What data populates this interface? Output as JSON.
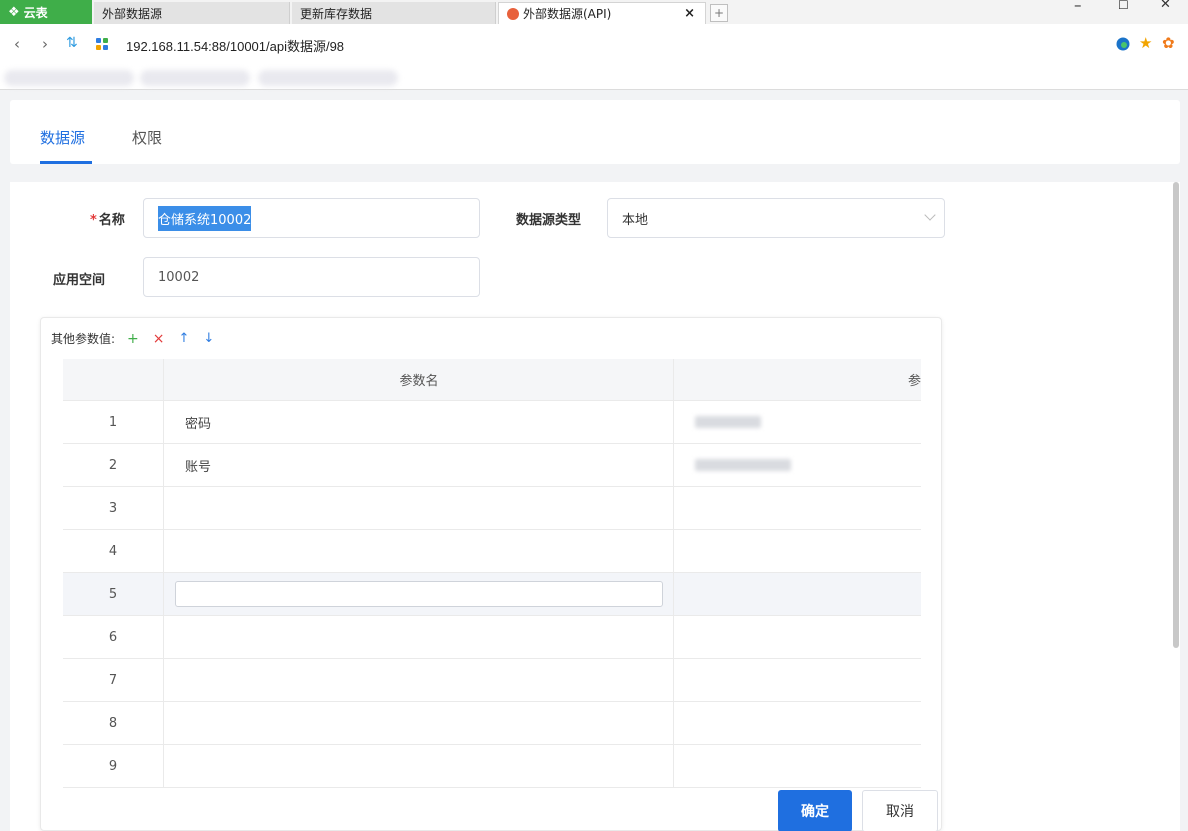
{
  "browser": {
    "tabs": [
      {
        "label": "云表",
        "icon": "yunbiao-logo-icon"
      },
      {
        "label": "外部数据源"
      },
      {
        "label": "更新库存数据"
      },
      {
        "label": "外部数据源(API)",
        "icon": "app-logo-icon",
        "close": "×"
      }
    ],
    "new_tab_glyph": "+",
    "window_controls": {
      "minimize": "–",
      "maximize": "☐",
      "close": "✕"
    },
    "address": "192.168.11.54:88/10001/api数据源/98",
    "accent_green": "#3fae49"
  },
  "page_tabs": [
    {
      "label": "数据源",
      "active": true
    },
    {
      "label": "权限",
      "active": false
    }
  ],
  "form": {
    "name_label": "名称",
    "name_required_mark": "*",
    "name_value": "仓储系统10002",
    "type_label": "数据源类型",
    "type_value": "本地",
    "space_label": "应用空间",
    "space_value": "10002"
  },
  "params": {
    "label": "其他参数值:",
    "toolbar": {
      "add": "+",
      "delete": "×",
      "up": "↑",
      "down": "↓"
    },
    "headers": {
      "name": "参数名",
      "value": "参"
    },
    "rows": [
      {
        "index": "1",
        "name": "密码",
        "value": ""
      },
      {
        "index": "2",
        "name": "账号",
        "value": ""
      },
      {
        "index": "3",
        "name": "",
        "value": ""
      },
      {
        "index": "4",
        "name": "",
        "value": ""
      },
      {
        "index": "5",
        "name": "",
        "value": "",
        "editing": true
      },
      {
        "index": "6",
        "name": "",
        "value": ""
      },
      {
        "index": "7",
        "name": "",
        "value": ""
      },
      {
        "index": "8",
        "name": "",
        "value": ""
      },
      {
        "index": "9",
        "name": "",
        "value": ""
      }
    ]
  },
  "actions": {
    "confirm": "确定",
    "cancel": "取消"
  },
  "colors": {
    "primary": "#1f6fe0",
    "danger": "#e23a3a",
    "success": "#3fae49"
  }
}
